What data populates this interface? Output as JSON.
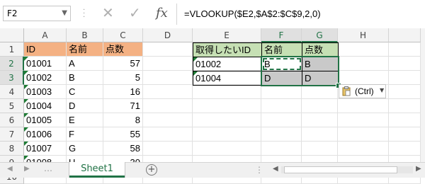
{
  "formula_bar": {
    "name_box": "F2",
    "formula": "=VLOOKUP($E2,$A$2:$C$9,2,0)",
    "icons": [
      "cancel-icon",
      "enter-check-icon",
      "fx-icon"
    ]
  },
  "columns": [
    "A",
    "B",
    "C",
    "D",
    "E",
    "F",
    "G",
    "H"
  ],
  "rows": [
    "1",
    "2",
    "3",
    "4",
    "5",
    "6",
    "7",
    "8",
    "9",
    "10"
  ],
  "source_table": {
    "headers": [
      "ID",
      "名前",
      "点数"
    ],
    "rows": [
      [
        "01001",
        "A",
        "57"
      ],
      [
        "01002",
        "B",
        "5"
      ],
      [
        "01003",
        "C",
        "16"
      ],
      [
        "01004",
        "D",
        "71"
      ],
      [
        "01005",
        "E",
        "8"
      ],
      [
        "01006",
        "F",
        "55"
      ],
      [
        "01007",
        "G",
        "58"
      ],
      [
        "01008",
        "H",
        "30"
      ]
    ]
  },
  "lookup_table": {
    "headers": [
      "取得したいID",
      "名前",
      "点数"
    ],
    "rows": [
      [
        "01002",
        "B",
        "B"
      ],
      [
        "01004",
        "D",
        "D"
      ]
    ]
  },
  "paste_options": {
    "label": "(Ctrl)"
  },
  "sheet_tabs": [
    "Sheet1"
  ],
  "colors": {
    "excel_green": "#217346",
    "orange_header": "#f4b183",
    "green_header": "#c6e0b4",
    "grey_cells": "#c9c9c9"
  }
}
